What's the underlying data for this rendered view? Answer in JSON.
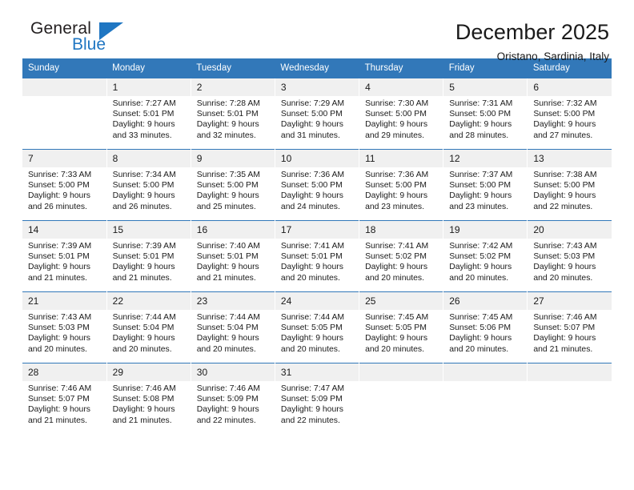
{
  "brand": {
    "name_part1": "General",
    "name_part2": "Blue",
    "triangle_color": "#1f76c2"
  },
  "header": {
    "month_title": "December 2025",
    "location": "Oristano, Sardinia, Italy"
  },
  "theme": {
    "header_blue": "#3278b9",
    "daynum_band": "#f0f0f0",
    "text": "#1a1a1a"
  },
  "weekday_headers": [
    "Sunday",
    "Monday",
    "Tuesday",
    "Wednesday",
    "Thursday",
    "Friday",
    "Saturday"
  ],
  "weeks": [
    [
      {
        "day": "",
        "sunrise": "",
        "sunset": "",
        "daylight_line1": "",
        "daylight_line2": ""
      },
      {
        "day": "1",
        "sunrise": "Sunrise: 7:27 AM",
        "sunset": "Sunset: 5:01 PM",
        "daylight_line1": "Daylight: 9 hours",
        "daylight_line2": "and 33 minutes."
      },
      {
        "day": "2",
        "sunrise": "Sunrise: 7:28 AM",
        "sunset": "Sunset: 5:01 PM",
        "daylight_line1": "Daylight: 9 hours",
        "daylight_line2": "and 32 minutes."
      },
      {
        "day": "3",
        "sunrise": "Sunrise: 7:29 AM",
        "sunset": "Sunset: 5:00 PM",
        "daylight_line1": "Daylight: 9 hours",
        "daylight_line2": "and 31 minutes."
      },
      {
        "day": "4",
        "sunrise": "Sunrise: 7:30 AM",
        "sunset": "Sunset: 5:00 PM",
        "daylight_line1": "Daylight: 9 hours",
        "daylight_line2": "and 29 minutes."
      },
      {
        "day": "5",
        "sunrise": "Sunrise: 7:31 AM",
        "sunset": "Sunset: 5:00 PM",
        "daylight_line1": "Daylight: 9 hours",
        "daylight_line2": "and 28 minutes."
      },
      {
        "day": "6",
        "sunrise": "Sunrise: 7:32 AM",
        "sunset": "Sunset: 5:00 PM",
        "daylight_line1": "Daylight: 9 hours",
        "daylight_line2": "and 27 minutes."
      }
    ],
    [
      {
        "day": "7",
        "sunrise": "Sunrise: 7:33 AM",
        "sunset": "Sunset: 5:00 PM",
        "daylight_line1": "Daylight: 9 hours",
        "daylight_line2": "and 26 minutes."
      },
      {
        "day": "8",
        "sunrise": "Sunrise: 7:34 AM",
        "sunset": "Sunset: 5:00 PM",
        "daylight_line1": "Daylight: 9 hours",
        "daylight_line2": "and 26 minutes."
      },
      {
        "day": "9",
        "sunrise": "Sunrise: 7:35 AM",
        "sunset": "Sunset: 5:00 PM",
        "daylight_line1": "Daylight: 9 hours",
        "daylight_line2": "and 25 minutes."
      },
      {
        "day": "10",
        "sunrise": "Sunrise: 7:36 AM",
        "sunset": "Sunset: 5:00 PM",
        "daylight_line1": "Daylight: 9 hours",
        "daylight_line2": "and 24 minutes."
      },
      {
        "day": "11",
        "sunrise": "Sunrise: 7:36 AM",
        "sunset": "Sunset: 5:00 PM",
        "daylight_line1": "Daylight: 9 hours",
        "daylight_line2": "and 23 minutes."
      },
      {
        "day": "12",
        "sunrise": "Sunrise: 7:37 AM",
        "sunset": "Sunset: 5:00 PM",
        "daylight_line1": "Daylight: 9 hours",
        "daylight_line2": "and 23 minutes."
      },
      {
        "day": "13",
        "sunrise": "Sunrise: 7:38 AM",
        "sunset": "Sunset: 5:00 PM",
        "daylight_line1": "Daylight: 9 hours",
        "daylight_line2": "and 22 minutes."
      }
    ],
    [
      {
        "day": "14",
        "sunrise": "Sunrise: 7:39 AM",
        "sunset": "Sunset: 5:01 PM",
        "daylight_line1": "Daylight: 9 hours",
        "daylight_line2": "and 21 minutes."
      },
      {
        "day": "15",
        "sunrise": "Sunrise: 7:39 AM",
        "sunset": "Sunset: 5:01 PM",
        "daylight_line1": "Daylight: 9 hours",
        "daylight_line2": "and 21 minutes."
      },
      {
        "day": "16",
        "sunrise": "Sunrise: 7:40 AM",
        "sunset": "Sunset: 5:01 PM",
        "daylight_line1": "Daylight: 9 hours",
        "daylight_line2": "and 21 minutes."
      },
      {
        "day": "17",
        "sunrise": "Sunrise: 7:41 AM",
        "sunset": "Sunset: 5:01 PM",
        "daylight_line1": "Daylight: 9 hours",
        "daylight_line2": "and 20 minutes."
      },
      {
        "day": "18",
        "sunrise": "Sunrise: 7:41 AM",
        "sunset": "Sunset: 5:02 PM",
        "daylight_line1": "Daylight: 9 hours",
        "daylight_line2": "and 20 minutes."
      },
      {
        "day": "19",
        "sunrise": "Sunrise: 7:42 AM",
        "sunset": "Sunset: 5:02 PM",
        "daylight_line1": "Daylight: 9 hours",
        "daylight_line2": "and 20 minutes."
      },
      {
        "day": "20",
        "sunrise": "Sunrise: 7:43 AM",
        "sunset": "Sunset: 5:03 PM",
        "daylight_line1": "Daylight: 9 hours",
        "daylight_line2": "and 20 minutes."
      }
    ],
    [
      {
        "day": "21",
        "sunrise": "Sunrise: 7:43 AM",
        "sunset": "Sunset: 5:03 PM",
        "daylight_line1": "Daylight: 9 hours",
        "daylight_line2": "and 20 minutes."
      },
      {
        "day": "22",
        "sunrise": "Sunrise: 7:44 AM",
        "sunset": "Sunset: 5:04 PM",
        "daylight_line1": "Daylight: 9 hours",
        "daylight_line2": "and 20 minutes."
      },
      {
        "day": "23",
        "sunrise": "Sunrise: 7:44 AM",
        "sunset": "Sunset: 5:04 PM",
        "daylight_line1": "Daylight: 9 hours",
        "daylight_line2": "and 20 minutes."
      },
      {
        "day": "24",
        "sunrise": "Sunrise: 7:44 AM",
        "sunset": "Sunset: 5:05 PM",
        "daylight_line1": "Daylight: 9 hours",
        "daylight_line2": "and 20 minutes."
      },
      {
        "day": "25",
        "sunrise": "Sunrise: 7:45 AM",
        "sunset": "Sunset: 5:05 PM",
        "daylight_line1": "Daylight: 9 hours",
        "daylight_line2": "and 20 minutes."
      },
      {
        "day": "26",
        "sunrise": "Sunrise: 7:45 AM",
        "sunset": "Sunset: 5:06 PM",
        "daylight_line1": "Daylight: 9 hours",
        "daylight_line2": "and 20 minutes."
      },
      {
        "day": "27",
        "sunrise": "Sunrise: 7:46 AM",
        "sunset": "Sunset: 5:07 PM",
        "daylight_line1": "Daylight: 9 hours",
        "daylight_line2": "and 21 minutes."
      }
    ],
    [
      {
        "day": "28",
        "sunrise": "Sunrise: 7:46 AM",
        "sunset": "Sunset: 5:07 PM",
        "daylight_line1": "Daylight: 9 hours",
        "daylight_line2": "and 21 minutes."
      },
      {
        "day": "29",
        "sunrise": "Sunrise: 7:46 AM",
        "sunset": "Sunset: 5:08 PM",
        "daylight_line1": "Daylight: 9 hours",
        "daylight_line2": "and 21 minutes."
      },
      {
        "day": "30",
        "sunrise": "Sunrise: 7:46 AM",
        "sunset": "Sunset: 5:09 PM",
        "daylight_line1": "Daylight: 9 hours",
        "daylight_line2": "and 22 minutes."
      },
      {
        "day": "31",
        "sunrise": "Sunrise: 7:47 AM",
        "sunset": "Sunset: 5:09 PM",
        "daylight_line1": "Daylight: 9 hours",
        "daylight_line2": "and 22 minutes."
      },
      {
        "day": "",
        "sunrise": "",
        "sunset": "",
        "daylight_line1": "",
        "daylight_line2": ""
      },
      {
        "day": "",
        "sunrise": "",
        "sunset": "",
        "daylight_line1": "",
        "daylight_line2": ""
      },
      {
        "day": "",
        "sunrise": "",
        "sunset": "",
        "daylight_line1": "",
        "daylight_line2": ""
      }
    ]
  ]
}
